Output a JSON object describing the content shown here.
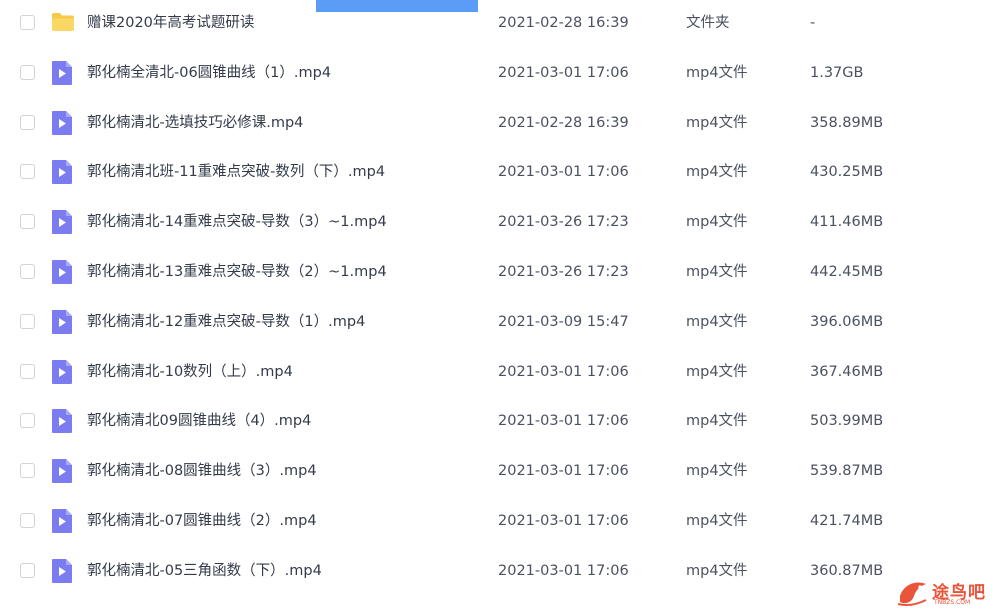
{
  "colors": {
    "folder_icon": "#f7c94b",
    "video_icon": "#7b7cf0",
    "text_primary": "#333b4a",
    "text_secondary": "#4a5160",
    "accent_bar": "#5b9cf6",
    "watermark": "#e8553a"
  },
  "files": [
    {
      "name": "赠课2020年高考试题研读",
      "date": "2021-02-28 16:39",
      "type": "文件夹",
      "size": "-",
      "icon": "folder-icon"
    },
    {
      "name": "郭化楠全清北-06圆锥曲线（1）.mp4",
      "date": "2021-03-01 17:06",
      "type": "mp4文件",
      "size": "1.37GB",
      "icon": "video-file-icon"
    },
    {
      "name": "郭化楠清北-选填技巧必修课.mp4",
      "date": "2021-02-28 16:39",
      "type": "mp4文件",
      "size": "358.89MB",
      "icon": "video-file-icon"
    },
    {
      "name": "郭化楠清北班-11重难点突破-数列（下）.mp4",
      "date": "2021-03-01 17:06",
      "type": "mp4文件",
      "size": "430.25MB",
      "icon": "video-file-icon"
    },
    {
      "name": "郭化楠清北-14重难点突破-导数（3）~1.mp4",
      "date": "2021-03-26 17:23",
      "type": "mp4文件",
      "size": "411.46MB",
      "icon": "video-file-icon"
    },
    {
      "name": "郭化楠清北-13重难点突破-导数（2）~1.mp4",
      "date": "2021-03-26 17:23",
      "type": "mp4文件",
      "size": "442.45MB",
      "icon": "video-file-icon"
    },
    {
      "name": "郭化楠清北-12重难点突破-导数（1）.mp4",
      "date": "2021-03-09 15:47",
      "type": "mp4文件",
      "size": "396.06MB",
      "icon": "video-file-icon"
    },
    {
      "name": "郭化楠清北-10数列（上）.mp4",
      "date": "2021-03-01 17:06",
      "type": "mp4文件",
      "size": "367.46MB",
      "icon": "video-file-icon"
    },
    {
      "name": "郭化楠清北09圆锥曲线（4）.mp4",
      "date": "2021-03-01 17:06",
      "type": "mp4文件",
      "size": "503.99MB",
      "icon": "video-file-icon"
    },
    {
      "name": "郭化楠清北-08圆锥曲线（3）.mp4",
      "date": "2021-03-01 17:06",
      "type": "mp4文件",
      "size": "539.87MB",
      "icon": "video-file-icon"
    },
    {
      "name": "郭化楠清北-07圆锥曲线（2）.mp4",
      "date": "2021-03-01 17:06",
      "type": "mp4文件",
      "size": "421.74MB",
      "icon": "video-file-icon"
    },
    {
      "name": "郭化楠清北-05三角函数（下）.mp4",
      "date": "2021-03-01 17:06",
      "type": "mp4文件",
      "size": "360.87MB",
      "icon": "video-file-icon"
    }
  ],
  "watermark": {
    "text": "途鸟吧",
    "sub": "TNBZS.COM"
  }
}
